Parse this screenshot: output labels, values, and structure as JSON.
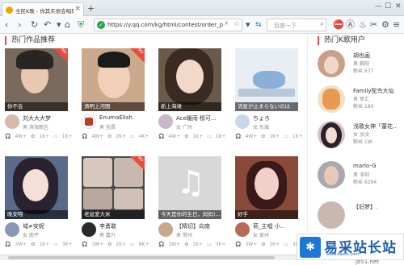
{
  "browser": {
    "tab_title": "全民K歌 - 你其实很会唱歌",
    "address_url": "https://y.qq.com/kg/html/contest/order_p",
    "search_placeholder": "百度一下",
    "icons": [
      "back-icon",
      "forward-icon",
      "reload-icon",
      "undo-icon",
      "home-icon",
      "star-icon"
    ]
  },
  "main": {
    "section_title": "热门作品推荐",
    "works": [
      {
        "caption": "你不会",
        "badge": "MV",
        "user": "刘大大大梦",
        "loc": "男  滨海新区",
        "stats": [
          "4W+",
          "1K+",
          "1K+"
        ],
        "thumb_bg": "#7a6a5e"
      },
      {
        "caption": "清明上河图",
        "badge": "MV",
        "user": "EnumaElish",
        "loc": "男  宜昌",
        "stats": [
          "4W+",
          "2K+",
          "4K+"
        ],
        "thumb_bg": "#caa98c"
      },
      {
        "caption": "新上海滩",
        "badge": "",
        "user": "Ace暖雨·榜可...",
        "loc": "女  广州",
        "stats": [
          "4W+",
          "1K+",
          "1K+"
        ],
        "thumb_bg": "#6b5a4a"
      },
      {
        "caption": "流星が止まらないのは",
        "badge": "",
        "user": "ちょろ",
        "loc": "女  东城",
        "stats": [
          "4W+",
          "1K+",
          "1K+"
        ],
        "thumb_bg": "#e8eef4"
      },
      {
        "caption": "晚安喵",
        "badge": "",
        "user": "域≠安妮",
        "loc": "女  南平",
        "stats": [
          "3W+",
          "1K+",
          "3K+"
        ],
        "thumb_bg": "#5a6a8a"
      },
      {
        "caption": "老鼠爱大米",
        "badge": "MV",
        "user": "李勇敢",
        "loc": "男  嘉兴",
        "stats": [
          "3W+",
          "2K+",
          "8K+"
        ],
        "thumb_bg": "#4a4a4a"
      },
      {
        "caption": "今天是你的生日，妈妈!...",
        "badge": "",
        "user": "【精切】向南",
        "loc": "男  常州",
        "stats": [
          "3W+",
          "1K+",
          "3K+"
        ],
        "thumb_bg": "#d8d8d8"
      },
      {
        "caption": "好手",
        "badge": "",
        "user": "莉_主唱 小..",
        "loc": "女  泉州",
        "stats": [
          "3W+",
          "1K+",
          "3K+"
        ],
        "thumb_bg": "#8a4a3a"
      }
    ]
  },
  "sidebar": {
    "section_title": "热门K歌用户",
    "users": [
      {
        "name": "胡也画",
        "gender": "男",
        "loc": "朝阳",
        "fans": "粉丝 677"
      },
      {
        "name": "Family驼鸟大仙",
        "gender": "男",
        "loc": "徐汇",
        "fans": "粉丝 189"
      },
      {
        "name": "浅歌女神「蕾花..",
        "gender": "女",
        "loc": "汝汶",
        "fans": "粉丝 1W"
      },
      {
        "name": "marlo-G",
        "gender": "男",
        "loc": "深圳",
        "fans": "粉丝 6294"
      },
      {
        "name": "【旧梦】.",
        "gender": "",
        "loc": "",
        "fans": ""
      }
    ]
  },
  "watermark": {
    "logo_char": "✱",
    "text": "易采站长站",
    "url": "www.easck.com",
    "small": "jb51.net"
  }
}
